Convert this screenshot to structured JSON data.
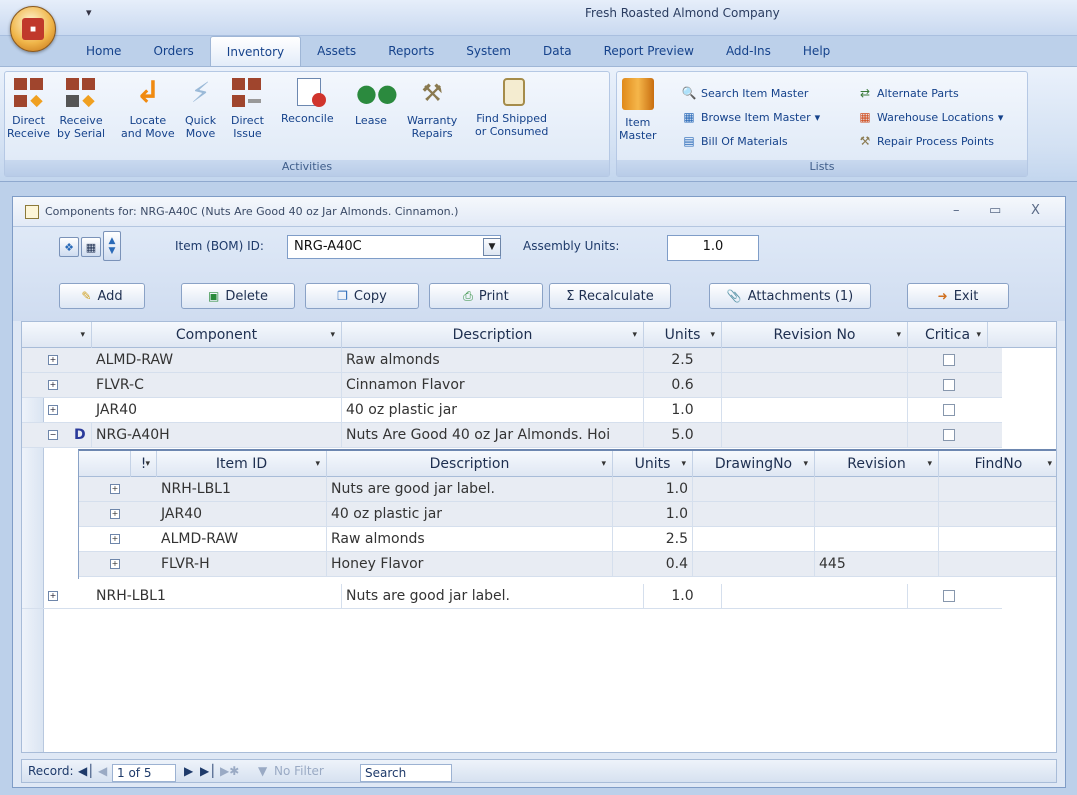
{
  "app": {
    "title": "Fresh Roasted Almond Company",
    "qat_label": "▾"
  },
  "tabs": [
    "Home",
    "Orders",
    "Inventory",
    "Assets",
    "Reports",
    "System",
    "Data",
    "Report Preview",
    "Add-Ins",
    "Help"
  ],
  "active_tab": "Inventory",
  "ribbon": {
    "activities": {
      "label": "Activities",
      "buttons": [
        {
          "line1": "Direct",
          "line2": "Receive"
        },
        {
          "line1": "Receive",
          "line2": "by Serial"
        },
        {
          "line1": "Locate",
          "line2": "and Move"
        },
        {
          "line1": "Quick",
          "line2": "Move"
        },
        {
          "line1": "Direct",
          "line2": "Issue"
        },
        {
          "line1": "Reconcile",
          "line2": ""
        },
        {
          "line1": "Lease",
          "line2": ""
        },
        {
          "line1": "Warranty",
          "line2": "Repairs"
        },
        {
          "line1": "Find Shipped",
          "line2": "or Consumed"
        }
      ]
    },
    "lists": {
      "label": "Lists",
      "item_master": {
        "line1": "Item",
        "line2": "Master"
      },
      "search_item_master": "Search Item Master",
      "browse_item_master": "Browse Item Master",
      "bill_of_materials": "Bill Of Materials",
      "alternate_parts": "Alternate Parts",
      "warehouse_locations": "Warehouse Locations",
      "repair_process_points": "Repair Process Points"
    }
  },
  "window": {
    "caption": "Components for: NRG-A40C (Nuts Are Good 40 oz Jar Almonds. Cinnamon.)",
    "minimize": "–",
    "maximize": "▭",
    "close": "X"
  },
  "form": {
    "item_label": "Item (BOM) ID:",
    "item_value": "NRG-A40C",
    "assembly_label": "Assembly Units:",
    "assembly_value": "1.0",
    "buttons": {
      "add": "Add",
      "delete": "Delete",
      "copy": "Copy",
      "print": "Print",
      "recalculate": "Σ Recalculate",
      "attachments": "Attachments (1)",
      "exit": "Exit"
    }
  },
  "grid": {
    "headers": [
      "Component",
      "Description",
      "Units",
      "Revision No",
      "Critica"
    ],
    "rows": [
      {
        "component": "ALMD-RAW",
        "description": "Raw almonds",
        "units": "2.5"
      },
      {
        "component": "FLVR-C",
        "description": "Cinnamon Flavor",
        "units": "0.6"
      },
      {
        "component": "JAR40",
        "description": "40 oz plastic jar",
        "units": "1.0"
      },
      {
        "component": "NRG-A40H",
        "description": "Nuts Are Good 40 oz Jar Almonds. Hoi",
        "units": "5.0",
        "flag": "D"
      },
      {
        "component": "NRH-LBL1",
        "description": "Nuts are good jar label.",
        "units": "1.0"
      }
    ]
  },
  "subgrid": {
    "headers": [
      "!",
      "Item ID",
      "Description",
      "Units",
      "DrawingNo",
      "Revision",
      "FindNo"
    ],
    "rows": [
      {
        "item_id": "NRH-LBL1",
        "description": "Nuts are good jar label.",
        "units": "1.0",
        "drawing": "",
        "revision": ""
      },
      {
        "item_id": "JAR40",
        "description": "40 oz plastic jar",
        "units": "1.0",
        "drawing": "",
        "revision": ""
      },
      {
        "item_id": "ALMD-RAW",
        "description": "Raw almonds",
        "units": "2.5",
        "drawing": "",
        "revision": ""
      },
      {
        "item_id": "FLVR-H",
        "description": "Honey Flavor",
        "units": "0.4",
        "drawing": "",
        "revision": "445"
      }
    ]
  },
  "navbar": {
    "record_label": "Record:",
    "position": "1 of 5",
    "filter": "No Filter",
    "search": "Search"
  }
}
